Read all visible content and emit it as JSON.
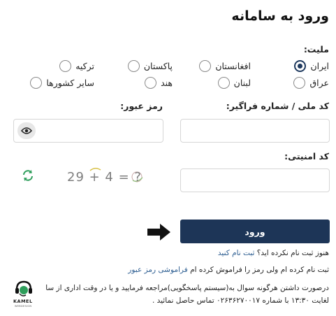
{
  "page": {
    "title": "ورود به سامانه"
  },
  "nationality": {
    "label": "ملیت:",
    "options": [
      {
        "label": "ایران",
        "checked": true
      },
      {
        "label": "افغانستان",
        "checked": false
      },
      {
        "label": "پاکستان",
        "checked": false
      },
      {
        "label": "ترکیه",
        "checked": false
      },
      {
        "label": "عراق",
        "checked": false
      },
      {
        "label": "لبنان",
        "checked": false
      },
      {
        "label": "هند",
        "checked": false
      },
      {
        "label": "سایر کشورها",
        "checked": false
      }
    ]
  },
  "form": {
    "national_code_label": "کد ملی / شماره فراگیر:",
    "password_label": "رمز عبور:",
    "national_code_value": "",
    "password_value": "",
    "security_code_label": "کد امنیتی:",
    "security_code_value": "",
    "captcha_text": "29 + 4 = ?"
  },
  "icons": {
    "show_password": "eye-icon",
    "refresh_captcha": "refresh-icon",
    "pointer": "arrow-right-icon",
    "logo": "headset-logo-icon"
  },
  "actions": {
    "submit_label": "ورود",
    "not_registered_text": "هنوز ثبت نام نکرده اید؟",
    "register_link": "ثبت نام کنید",
    "forgot_text": "ثبت نام کرده ام ولی رمز را فراموش کرده ام",
    "forgot_link": "فراموشی رمز عبور"
  },
  "support": {
    "line1": "درصورت داشتن هرگونه سوال به(سیستم پاسخگویی)مراجعه فرمایید و یا در وقت اداری از سا",
    "line2": "لغایت ۱۳:۳۰ با شماره ۰۲۶۳۶۲۷۰۰۱۷ تماس حاصل نمائید ."
  },
  "logo": {
    "name": "KAMEL",
    "subtitle": "WEBDESIGN"
  },
  "colors": {
    "primary": "#1d3557",
    "link": "#2c5d91",
    "refresh": "#2e9e5b"
  }
}
